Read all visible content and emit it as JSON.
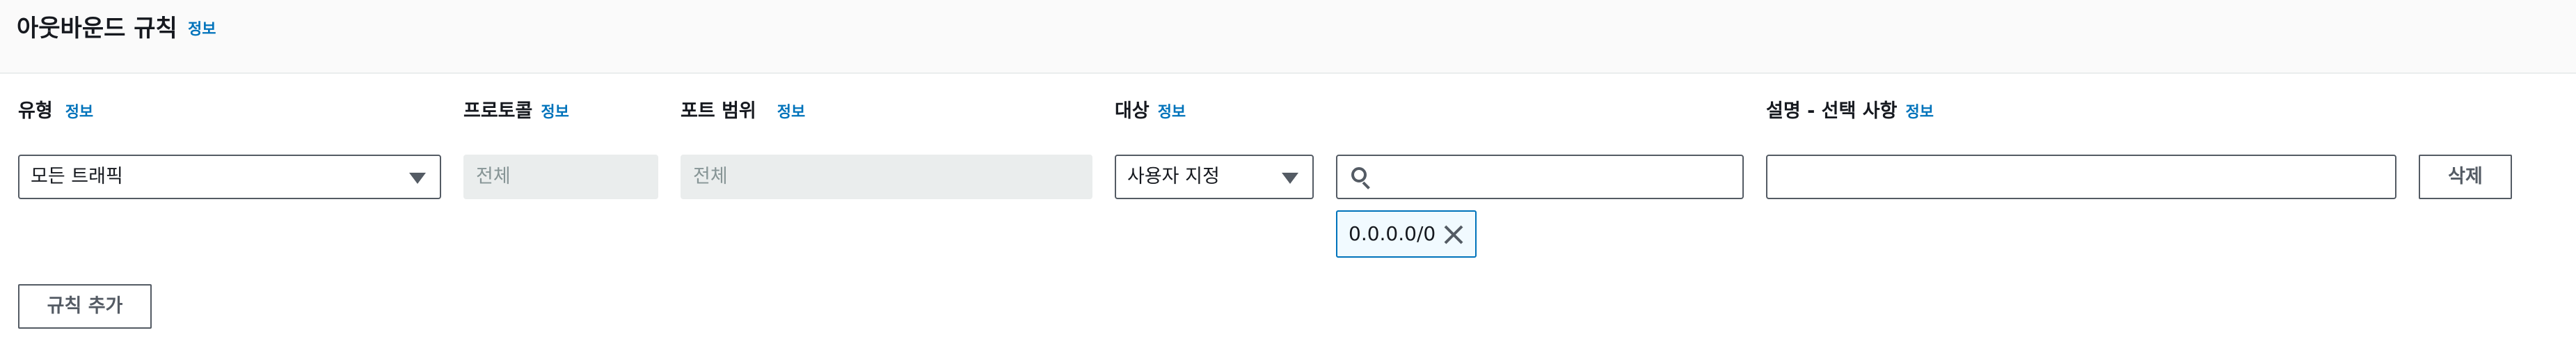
{
  "header": {
    "title": "아웃바운드 규칙",
    "info": "정보"
  },
  "columns": {
    "type": {
      "label": "유형",
      "info": "정보"
    },
    "protocol": {
      "label": "프로토콜",
      "info": "정보"
    },
    "port_range": {
      "label": "포트 범위",
      "info": "정보"
    },
    "destination": {
      "label": "대상",
      "info": "정보"
    },
    "description": {
      "label": "설명 - 선택 사항",
      "info": "정보"
    }
  },
  "rule": {
    "type_value": "모든 트래픽",
    "protocol_value": "전체",
    "port_range_value": "전체",
    "destination_type_value": "사용자 지정",
    "destination_search_value": "",
    "destination_token": "0.0.0.0/0",
    "description_value": "",
    "delete_label": "삭제"
  },
  "actions": {
    "add_rule_label": "규칙 추가"
  },
  "colors": {
    "link": "#0073bb",
    "border": "#545b64",
    "disabled_bg": "#eaeded",
    "header_bg": "#fafafa"
  }
}
